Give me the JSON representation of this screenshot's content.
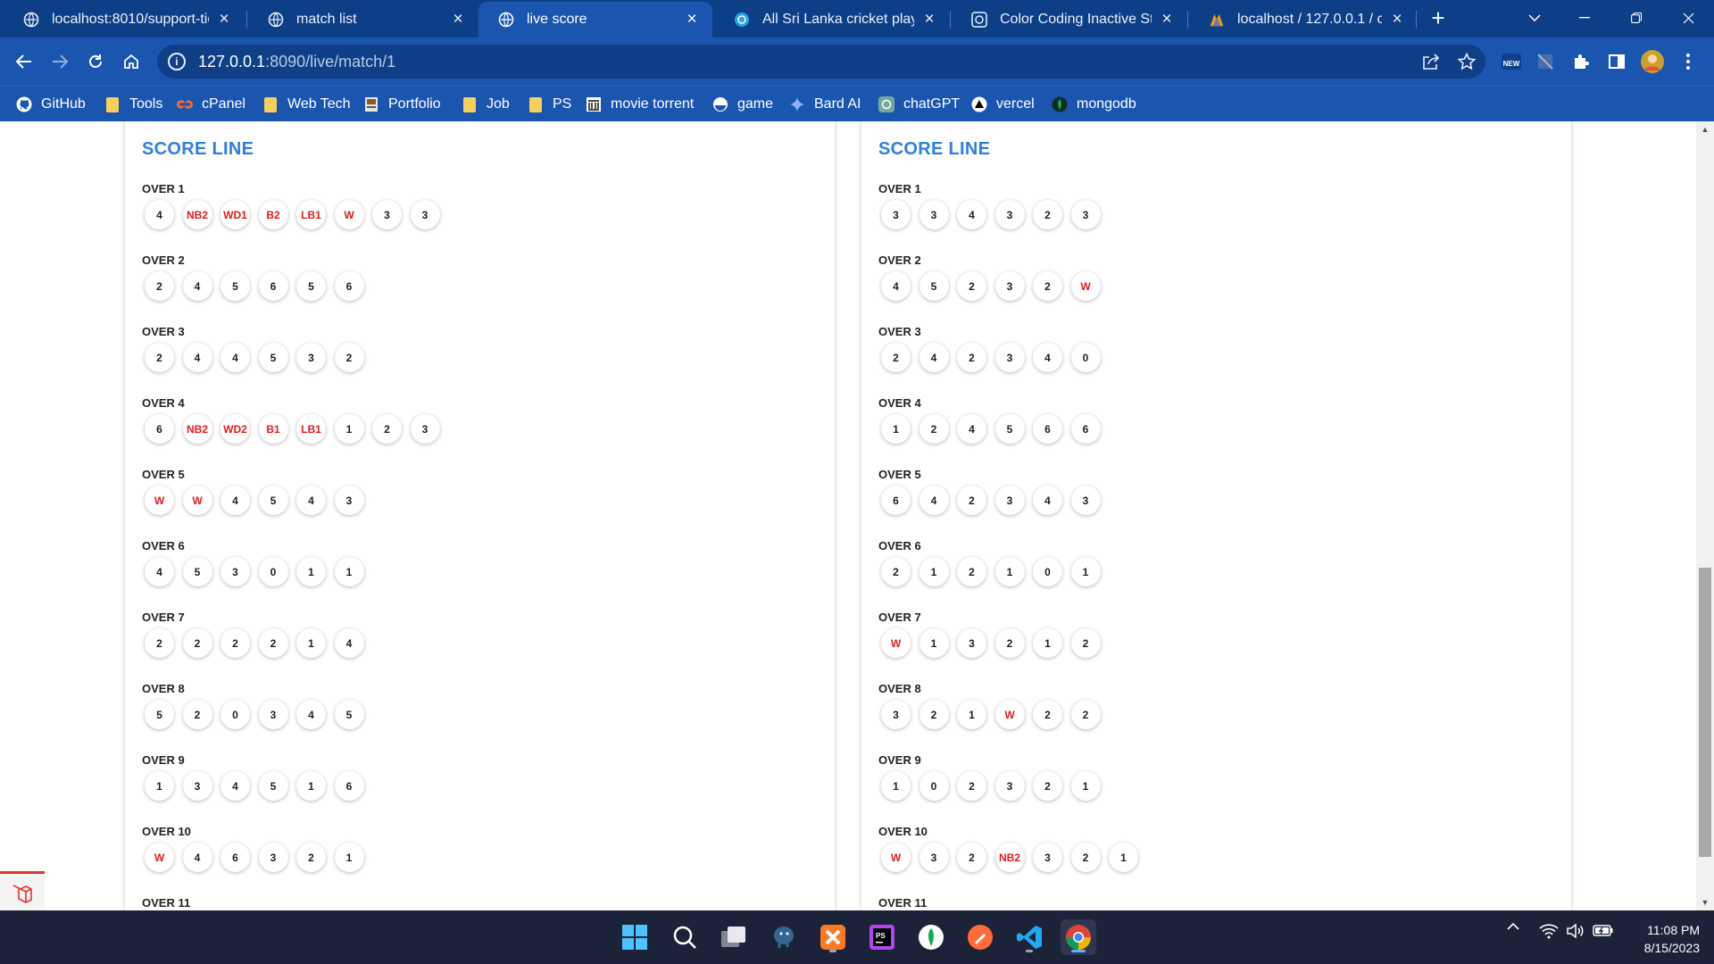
{
  "browser": {
    "tabs": [
      {
        "title": "localhost:8010/support-tick",
        "icon": "globe-icon",
        "active": false
      },
      {
        "title": "match list",
        "icon": "globe-icon",
        "active": false
      },
      {
        "title": "live score",
        "icon": "globe-icon",
        "active": true
      },
      {
        "title": "All Sri Lanka cricket players,",
        "icon": "site-icon",
        "active": false
      },
      {
        "title": "Color Coding Inactive Statu",
        "icon": "chatgpt-icon",
        "active": false
      },
      {
        "title": "localhost / 127.0.0.1 / cricke",
        "icon": "phpmyadmin-icon",
        "active": false
      }
    ],
    "new_tab": "+",
    "url_host": "127.0.0.1",
    "url_rest": ":8090/live/match/1",
    "extension_new_label": "NEW",
    "bookmarks": [
      {
        "label": "GitHub",
        "icon": "github-icon"
      },
      {
        "label": "Tools",
        "icon": "folder-icon"
      },
      {
        "label": "cPanel",
        "icon": "cpanel-icon"
      },
      {
        "label": "Web Tech",
        "icon": "folder-icon"
      },
      {
        "label": "Portfolio",
        "icon": "portfolio-icon"
      },
      {
        "label": "Job",
        "icon": "folder-icon"
      },
      {
        "label": "PS",
        "icon": "folder-icon"
      },
      {
        "label": "movie torrent",
        "icon": "museum-icon"
      },
      {
        "label": "game",
        "icon": "game-icon"
      },
      {
        "label": "Bard AI",
        "icon": "sparkle-icon"
      },
      {
        "label": "chatGPT",
        "icon": "chatgpt-icon"
      },
      {
        "label": "vercel",
        "icon": "vercel-icon"
      },
      {
        "label": "mongodb",
        "icon": "mongodb-icon"
      }
    ]
  },
  "colors": {
    "accent_blue": "#2f7fe0",
    "extra_red": "#e11d1d",
    "browser_frame": "#1a56b0"
  },
  "innings": [
    {
      "title": "SCORE LINE",
      "overs": [
        {
          "label": "OVER 1",
          "balls": [
            "4",
            "NB2",
            "WD1",
            "B2",
            "LB1",
            "W",
            "3",
            "3"
          ]
        },
        {
          "label": "OVER 2",
          "balls": [
            "2",
            "4",
            "5",
            "6",
            "5",
            "6"
          ]
        },
        {
          "label": "OVER 3",
          "balls": [
            "2",
            "4",
            "4",
            "5",
            "3",
            "2"
          ]
        },
        {
          "label": "OVER 4",
          "balls": [
            "6",
            "NB2",
            "WD2",
            "B1",
            "LB1",
            "1",
            "2",
            "3"
          ]
        },
        {
          "label": "OVER 5",
          "balls": [
            "W",
            "W",
            "4",
            "5",
            "4",
            "3"
          ]
        },
        {
          "label": "OVER 6",
          "balls": [
            "4",
            "5",
            "3",
            "0",
            "1",
            "1"
          ]
        },
        {
          "label": "OVER 7",
          "balls": [
            "2",
            "2",
            "2",
            "2",
            "1",
            "4"
          ]
        },
        {
          "label": "OVER 8",
          "balls": [
            "5",
            "2",
            "0",
            "3",
            "4",
            "5"
          ]
        },
        {
          "label": "OVER 9",
          "balls": [
            "1",
            "3",
            "4",
            "5",
            "1",
            "6"
          ]
        },
        {
          "label": "OVER 10",
          "balls": [
            "W",
            "4",
            "6",
            "3",
            "2",
            "1"
          ]
        },
        {
          "label": "OVER 11",
          "balls": []
        }
      ]
    },
    {
      "title": "SCORE LINE",
      "overs": [
        {
          "label": "OVER 1",
          "balls": [
            "3",
            "3",
            "4",
            "3",
            "2",
            "3"
          ]
        },
        {
          "label": "OVER 2",
          "balls": [
            "4",
            "5",
            "2",
            "3",
            "2",
            "W"
          ]
        },
        {
          "label": "OVER 3",
          "balls": [
            "2",
            "4",
            "2",
            "3",
            "4",
            "0"
          ]
        },
        {
          "label": "OVER 4",
          "balls": [
            "1",
            "2",
            "4",
            "5",
            "6",
            "6"
          ]
        },
        {
          "label": "OVER 5",
          "balls": [
            "6",
            "4",
            "2",
            "3",
            "4",
            "3"
          ]
        },
        {
          "label": "OVER 6",
          "balls": [
            "2",
            "1",
            "2",
            "1",
            "0",
            "1"
          ]
        },
        {
          "label": "OVER 7",
          "balls": [
            "W",
            "1",
            "3",
            "2",
            "1",
            "2"
          ]
        },
        {
          "label": "OVER 8",
          "balls": [
            "3",
            "2",
            "1",
            "W",
            "2",
            "2"
          ]
        },
        {
          "label": "OVER 9",
          "balls": [
            "1",
            "0",
            "2",
            "3",
            "2",
            "1"
          ]
        },
        {
          "label": "OVER 10",
          "balls": [
            "W",
            "3",
            "2",
            "NB2",
            "3",
            "2",
            "1"
          ]
        },
        {
          "label": "OVER 11",
          "balls": []
        }
      ]
    }
  ],
  "taskbar": {
    "apps": [
      {
        "name": "start-menu-icon"
      },
      {
        "name": "search-icon"
      },
      {
        "name": "task-view-icon"
      },
      {
        "name": "postgresql-icon"
      },
      {
        "name": "xampp-icon"
      },
      {
        "name": "phpstorm-icon"
      },
      {
        "name": "mongodb-compass-icon"
      },
      {
        "name": "postman-icon"
      },
      {
        "name": "vscode-icon"
      },
      {
        "name": "chrome-icon"
      }
    ],
    "time": "11:08 PM",
    "date": "8/15/2023"
  }
}
